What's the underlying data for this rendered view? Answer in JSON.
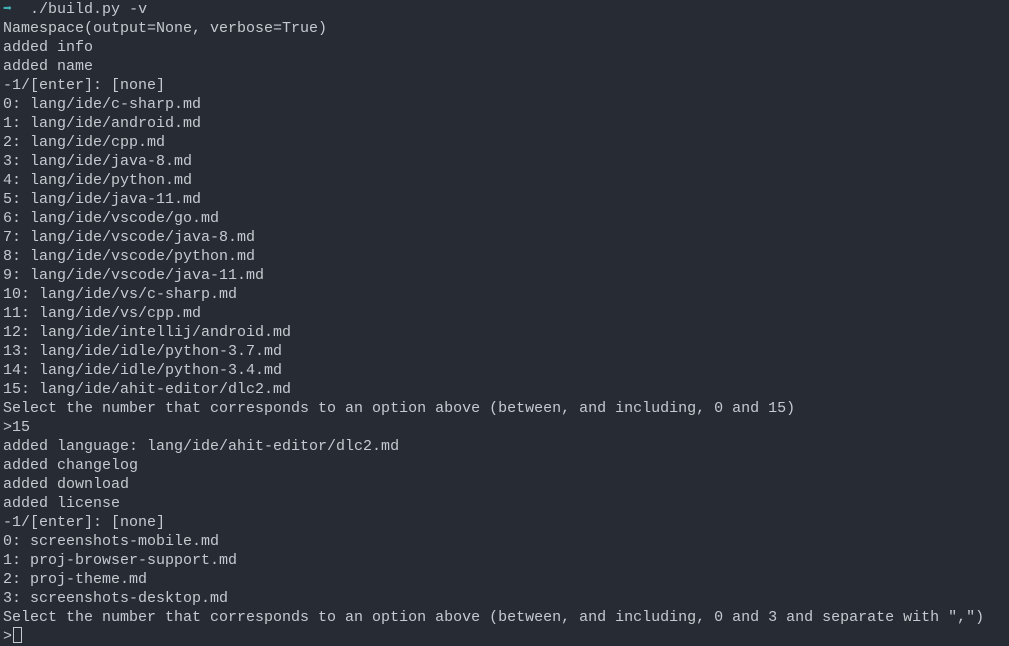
{
  "prompt": {
    "arrow": "➡",
    "command": "./build.py -v"
  },
  "output": [
    "Namespace(output=None, verbose=True)",
    "added info",
    "added name",
    "-1/[enter]: [none]",
    "0: lang/ide/c-sharp.md",
    "1: lang/ide/android.md",
    "2: lang/ide/cpp.md",
    "3: lang/ide/java-8.md",
    "4: lang/ide/python.md",
    "5: lang/ide/java-11.md",
    "6: lang/ide/vscode/go.md",
    "7: lang/ide/vscode/java-8.md",
    "8: lang/ide/vscode/python.md",
    "9: lang/ide/vscode/java-11.md",
    "10: lang/ide/vs/c-sharp.md",
    "11: lang/ide/vs/cpp.md",
    "12: lang/ide/intellij/android.md",
    "13: lang/ide/idle/python-3.7.md",
    "14: lang/ide/idle/python-3.4.md",
    "15: lang/ide/ahit-editor/dlc2.md",
    "Select the number that corresponds to an option above (between, and including, 0 and 15)",
    ">15",
    "added language: lang/ide/ahit-editor/dlc2.md",
    "added changelog",
    "added download",
    "added license",
    "-1/[enter]: [none]",
    "0: screenshots-mobile.md",
    "1: proj-browser-support.md",
    "2: proj-theme.md",
    "3: screenshots-desktop.md",
    "Select the number that corresponds to an option above (between, and including, 0 and 3 and separate with \",\")"
  ],
  "input_line": {
    "prompt": ">",
    "value": ""
  }
}
